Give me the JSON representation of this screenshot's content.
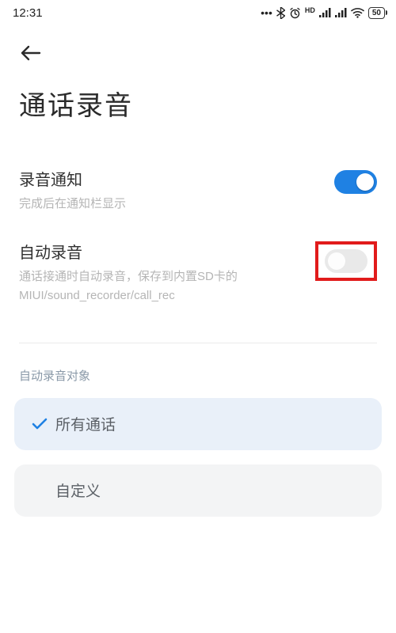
{
  "status": {
    "time": "12:31",
    "battery": "50"
  },
  "page": {
    "title": "通话录音"
  },
  "settings": {
    "notify": {
      "title": "录音通知",
      "desc": "完成后在通知栏显示",
      "on": true
    },
    "auto": {
      "title": "自动录音",
      "desc": "通话接通时自动录音，保存到内置SD卡的MIUI/sound_recorder/call_rec",
      "on": false
    }
  },
  "section": {
    "label": "自动录音对象",
    "options": [
      {
        "label": "所有通话",
        "selected": true
      },
      {
        "label": "自定义",
        "selected": false
      }
    ]
  },
  "colors": {
    "accent": "#1f81e3",
    "highlight": "#e11b1b"
  }
}
